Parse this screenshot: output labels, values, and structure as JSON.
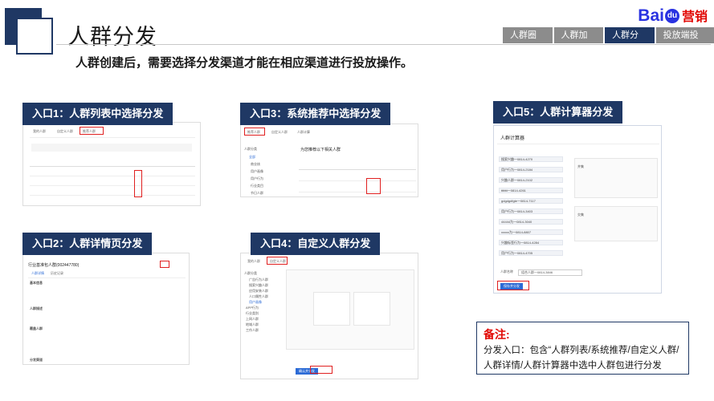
{
  "title": "人群分发",
  "subtitle": "人群创建后，需要选择分发渠道才能在相应渠道进行投放操作。",
  "logo": {
    "brand_text": "Bai",
    "brand_paw": "du",
    "brand_cn": "营销"
  },
  "nav_tabs": [
    {
      "label": "人群圈选",
      "active": false
    },
    {
      "label": "人群加工",
      "active": false
    },
    {
      "label": "人群分发",
      "active": true
    },
    {
      "label": "投放端投放",
      "active": false
    }
  ],
  "entries": {
    "entry1": "入口1：人群列表中选择分发",
    "entry2": "入口2：人群详情页分发",
    "entry3": "入口3：系统推荐中选择分发",
    "entry4": "入口4：自定义人群分发",
    "entry5": "入口5：人群计算器分发"
  },
  "note": {
    "title": "备注:",
    "body": "分发入口：包含“人群列表/系统推荐/自定义人群/人群详情/人群计算器中选中人群包进行分发"
  },
  "mock": {
    "list_tabs": [
      "我的人群",
      "自定义人群",
      "推荐人群"
    ],
    "detail_title": "行业基准包人群(002447780)",
    "detail_tabs": [
      "人群详情",
      "历史记录"
    ],
    "detail_sections": [
      "基本信息",
      "人群描述",
      "覆盖人群",
      "分发渠道"
    ],
    "rec_header": "为您推荐以下相关人群",
    "rec_tabs": [
      "推荐人群",
      "自定义人群",
      "人群计算"
    ],
    "rec_sidebar": [
      "人群分类",
      "全部",
      "商业核",
      "用户画像",
      "用户行为",
      "行业类目",
      "节日人群"
    ],
    "custom_tabs": [
      "我的人群",
      "自定义人群"
    ],
    "custom_sidebar": [
      "人群分类",
      "广告行为人群",
      "搜索兴趣人群",
      "应用安装人群",
      "人口属性人群",
      "用户画像",
      "APP行为",
      "行业类别",
      "上网人群",
      "地域人群",
      "工作人群"
    ],
    "custom_btn": "确认并分发",
    "calc_title": "人群计算器",
    "calc_tabs": [
      "新增人群",
      "交集",
      "并集"
    ],
    "calc_list": [
      "搜索兴趣一0814-4270",
      "用户行为一0814-2184",
      "兴趣人群一0814-2102",
      "ttttttt一0814-4261",
      "gdgdgdfgte一0814-7117",
      "用户行为一0814-3403",
      "44444为一0814-3040",
      "xxxxx为一0814-8807",
      "兴趣标签行为一0814-4284",
      "用户行为一0814-4705"
    ],
    "calc_name_label": "人群名称",
    "calc_name_value": "组合人群一0814-3846",
    "calc_btn": "保存并分发"
  }
}
